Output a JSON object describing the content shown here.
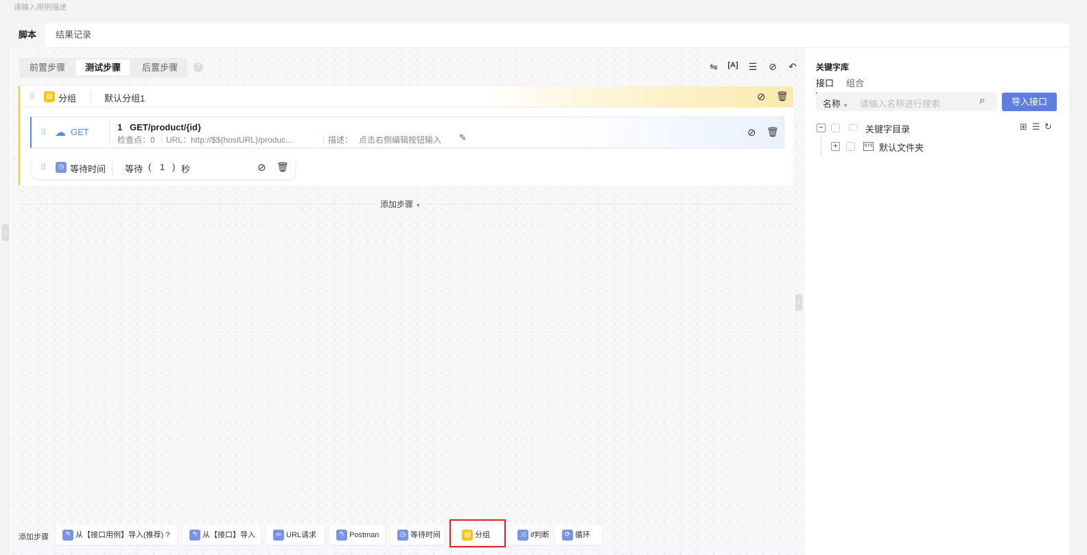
{
  "description_placeholder": "请输入用例描述",
  "tabs": [
    "脚本",
    "结果记录"
  ],
  "step_tabs": [
    "前置步骤",
    "测试步骤",
    "后置步骤"
  ],
  "group": {
    "type": "分组",
    "name": "默认分组1"
  },
  "get_step": {
    "method": "GET",
    "index": "1",
    "title": "GET/product/{id}",
    "checkpoints": "检查点：0",
    "url": "URL：http://$${hostURL}/produc...",
    "desc_label": "描述：",
    "desc_value": "点击右侧编辑按钮输入"
  },
  "wait_step": {
    "type": "等待时间",
    "prefix": "等待",
    "paren_open": "(",
    "value": "1",
    "paren_close": ")",
    "unit": "秒"
  },
  "add_step_label": "添加步骤",
  "bottom": {
    "label": "添加步骤",
    "buttons": [
      "从【接口用例】导入(推荐)",
      "从【接口】导入",
      "URL请求",
      "Postman",
      "等待时间",
      "分组",
      "if判断",
      "循环"
    ]
  },
  "right": {
    "title": "关键字库",
    "tabs": [
      "接口",
      "组合"
    ],
    "search_type": "名称",
    "search_placeholder": "请输入名称进行搜索",
    "import_button": "导入接口",
    "tree": {
      "root": "关键字目录",
      "child": "默认文件夹"
    }
  },
  "colors": {
    "accent": "#5f7fe0",
    "group": "#f5c518",
    "get": "#4a8ff0",
    "highlight": "#e0201e"
  }
}
